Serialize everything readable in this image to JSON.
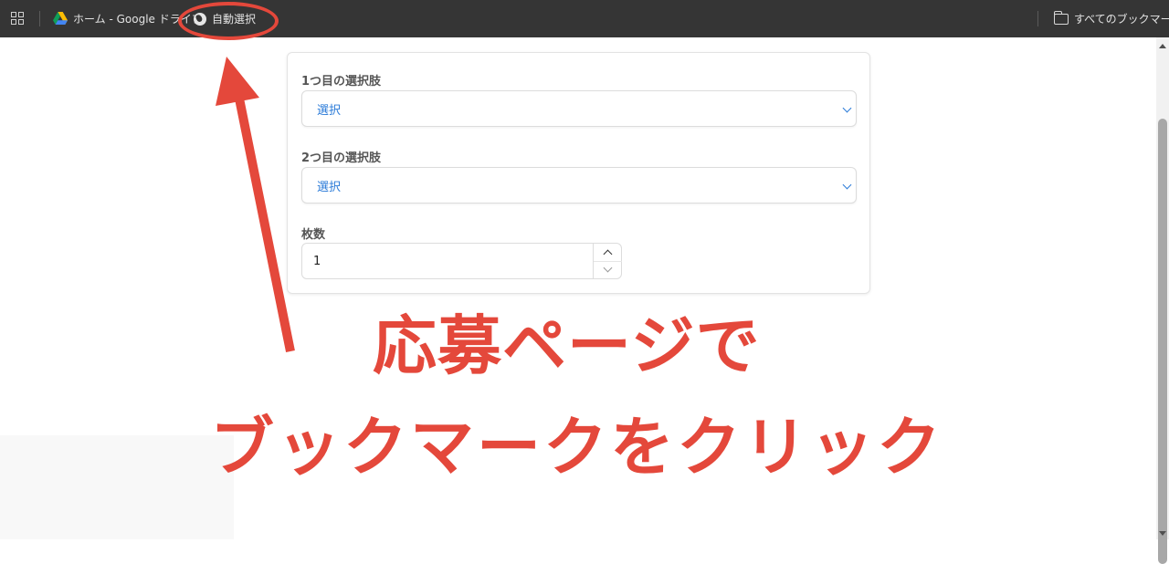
{
  "bookmarks_bar": {
    "items": [
      {
        "label": "ホーム - Google ドライブ",
        "icon": "google-drive-icon"
      },
      {
        "label": "自動選択",
        "icon": "globe-icon"
      }
    ],
    "all_bookmarks_label": "すべてのブックマーク"
  },
  "form": {
    "field1": {
      "label": "1つ目の選択肢",
      "selected": "選択"
    },
    "field2": {
      "label": "2つ目の選択肢",
      "selected": "選択"
    },
    "quantity": {
      "label": "枚数",
      "value": "1"
    }
  },
  "annotation": {
    "line1": "応募ページで",
    "line2": "ブックマークをクリック",
    "color": "#e4483b"
  },
  "colors": {
    "bar": "#353535",
    "select_text": "#2b7bd8"
  }
}
